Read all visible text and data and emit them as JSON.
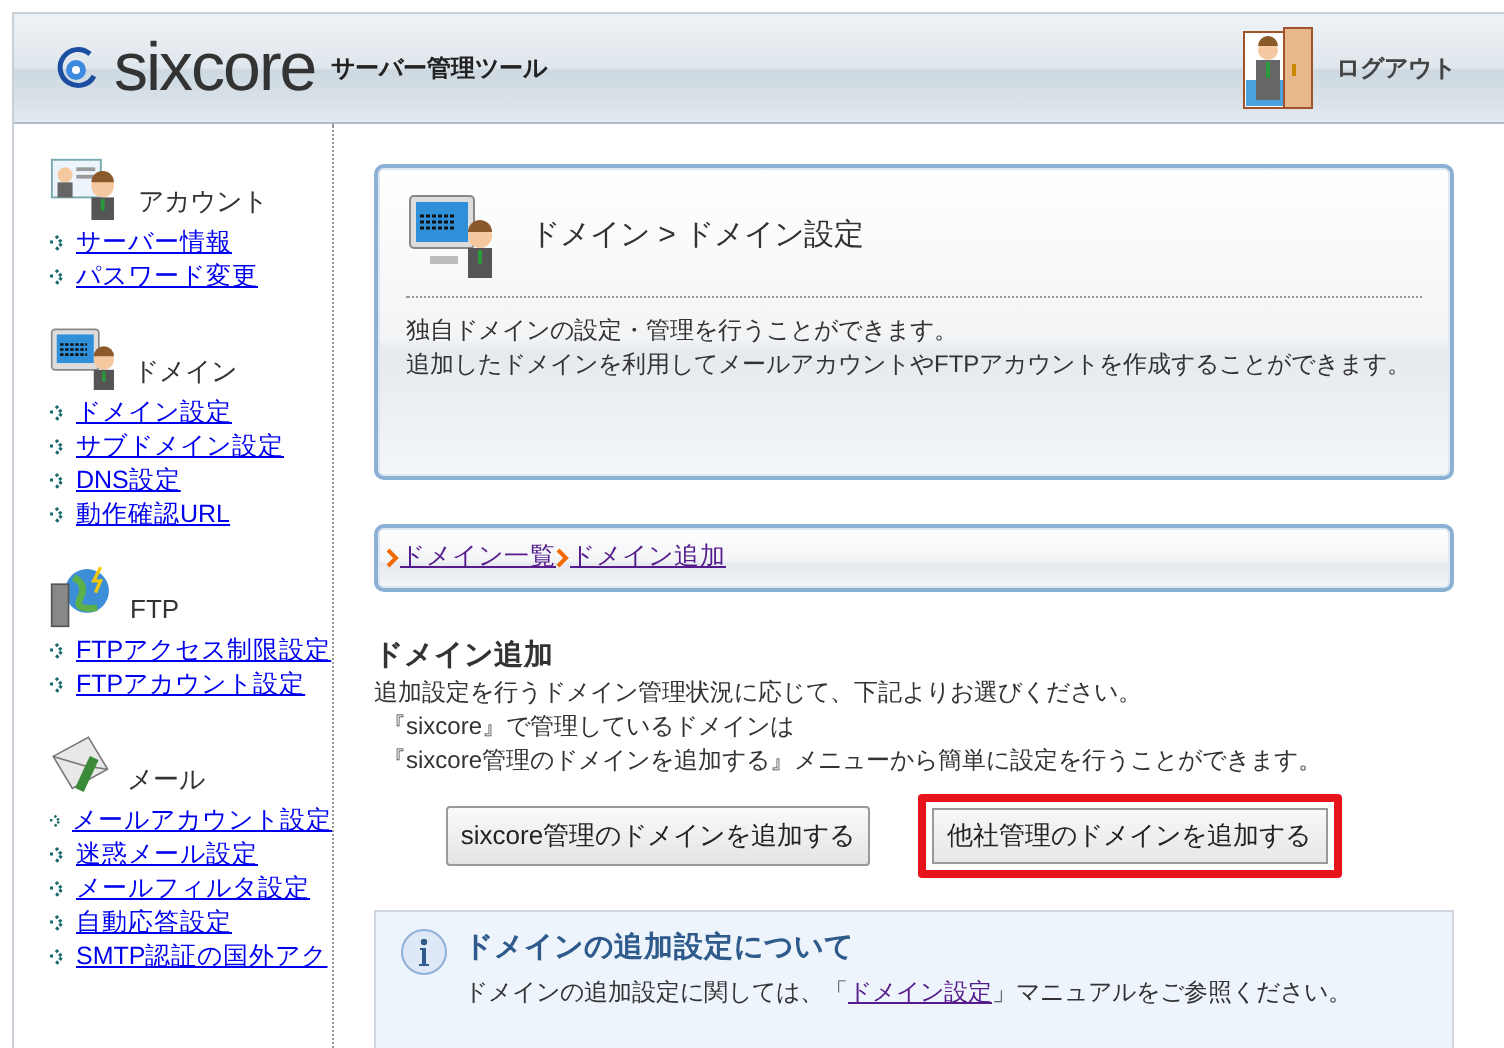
{
  "header": {
    "logo": "sixcore",
    "subtitle": "サーバー管理ツール",
    "logout": "ログアウト"
  },
  "sidebar": {
    "sections": [
      {
        "kind": "account",
        "title": "アカウント",
        "links": [
          "サーバー情報",
          "パスワード変更"
        ]
      },
      {
        "kind": "domain",
        "title": "ドメイン",
        "links": [
          "ドメイン設定",
          "サブドメイン設定",
          "DNS設定",
          "動作確認URL"
        ]
      },
      {
        "kind": "ftp",
        "title": "FTP",
        "links": [
          "FTPアクセス制限設定",
          "FTPアカウント設定"
        ]
      },
      {
        "kind": "mail",
        "title": "メール",
        "links": [
          "メールアカウント設定",
          "迷惑メール設定",
          "メールフィルタ設定",
          "自動応答設定",
          "SMTP認証の国外アク"
        ]
      }
    ]
  },
  "panel": {
    "title": "ドメイン > ドメイン設定",
    "description": [
      "独自ドメインの設定・管理を行うことができます。",
      "追加したドメインを利用してメールアカウントやFTPアカウントを作成することができます。"
    ]
  },
  "breadcrumb": [
    {
      "label": "ドメイン一覧",
      "visited": true
    },
    {
      "label": "ドメイン追加",
      "visited": true
    }
  ],
  "section": {
    "heading": "ドメイン追加",
    "lines": [
      "追加設定を行うドメイン管理状況に応じて、下記よりお選びください。",
      "『sixcore』で管理しているドメインは",
      "『sixcore管理のドメインを追加する』メニューから簡単に設定を行うことができます。"
    ]
  },
  "buttons": [
    {
      "label": "sixcore管理のドメインを追加する",
      "highlighted": false
    },
    {
      "label": "他社管理のドメインを追加する",
      "highlighted": true
    }
  ],
  "info": {
    "title": "ドメインの追加設定について",
    "text_before": "ドメインの追加設定に関しては、「",
    "link": "ドメイン設定",
    "link_visited": true,
    "text_after": "」マニュアルをご参照ください。"
  }
}
